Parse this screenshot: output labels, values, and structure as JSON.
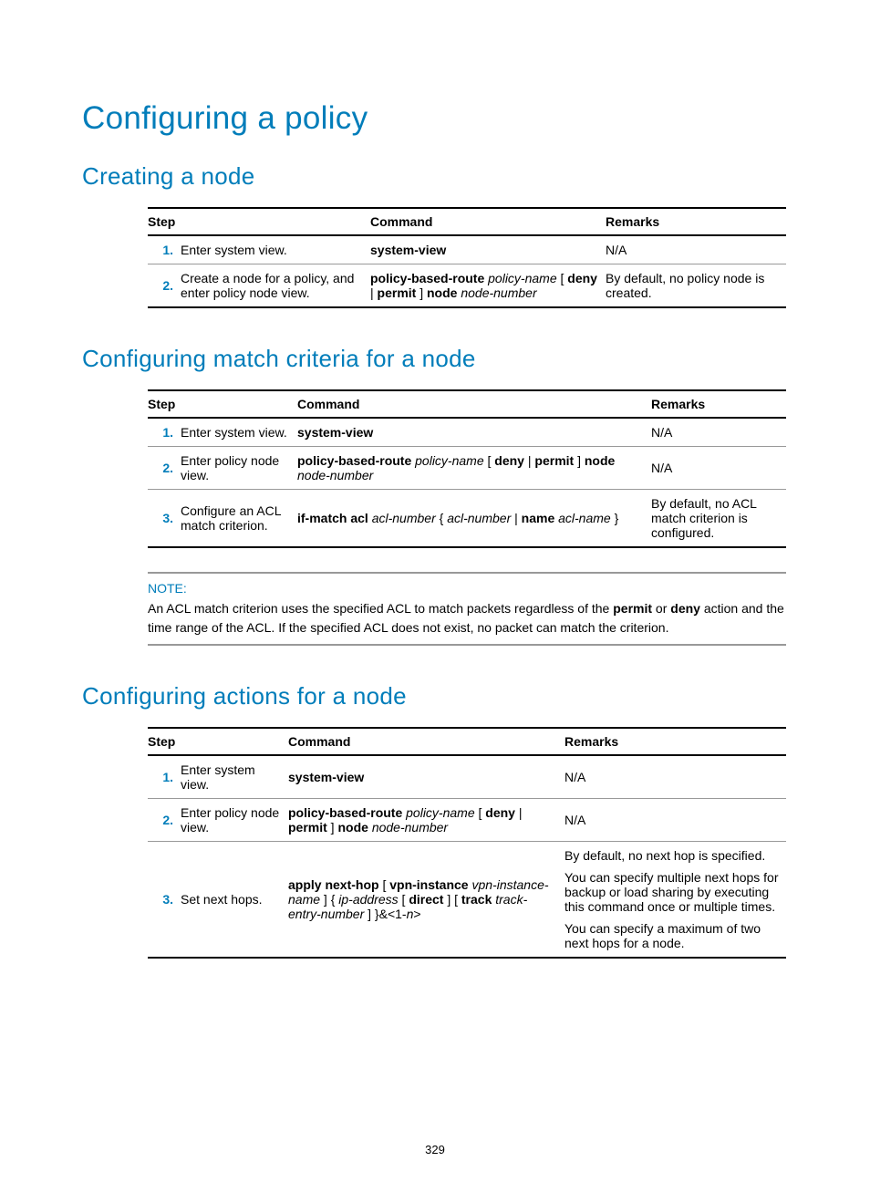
{
  "page_number": "329",
  "title": "Configuring a policy",
  "sections": [
    {
      "heading": "Creating a node",
      "table": {
        "headers": [
          "Step",
          "Command",
          "Remarks"
        ],
        "col_widths": {
          "step_desc": "200px",
          "command": "250px"
        },
        "rows": [
          {
            "num": "1.",
            "step": "Enter system view.",
            "command_html": "<span class='b'>system-view</span>",
            "remarks_html": "N/A"
          },
          {
            "num": "2.",
            "step": "Create a node for a policy, and enter policy node view.",
            "command_html": "<span class='b'>policy-based-route</span> <span class='i'>policy-name</span> [ <span class='b'>deny</span> | <span class='b'>permit</span> ] <span class='b'>node</span> <span class='i'>node-number</span>",
            "remarks_html": "By default, no policy node is created."
          }
        ]
      }
    },
    {
      "heading": "Configuring match criteria for a node",
      "table": {
        "headers": [
          "Step",
          "Command",
          "Remarks"
        ],
        "col_widths": {
          "step_desc": "120px",
          "command": "380px"
        },
        "rows": [
          {
            "num": "1.",
            "step": "Enter system view.",
            "command_html": "<span class='b'>system-view</span>",
            "remarks_html": "N/A"
          },
          {
            "num": "2.",
            "step": "Enter policy node view.",
            "command_html": "<span class='b'>policy-based-route</span> <span class='i'>policy-name</span> [ <span class='b'>deny</span> | <span class='b'>permit</span> ] <span class='b'>node</span> <span class='i'>node-number</span>",
            "remarks_html": "N/A"
          },
          {
            "num": "3.",
            "step": "Configure an ACL match criterion.",
            "command_html": "<span class='b'>if-match acl</span> <span class='i'>acl-number</span> { <span class='i'>acl-number</span> | <span class='b'>name</span> <span class='i'>acl-name</span> }",
            "remarks_html": "By default, no ACL match criterion is configured."
          }
        ]
      },
      "note": {
        "label": "NOTE:",
        "text_html": "An ACL match criterion uses the specified ACL to match packets regardless of the <span class='b'>permit</span> or <span class='b'>deny</span> action and the time range of the ACL. If the specified ACL does not exist, no packet can match the criterion."
      }
    },
    {
      "heading": "Configuring actions for a node",
      "table": {
        "headers": [
          "Step",
          "Command",
          "Remarks"
        ],
        "col_widths": {
          "step_desc": "110px",
          "command": "295px"
        },
        "rows": [
          {
            "num": "1.",
            "step": "Enter system view.",
            "command_html": "<span class='b'>system-view</span>",
            "remarks_html": "N/A"
          },
          {
            "num": "2.",
            "step": "Enter policy node view.",
            "command_html": "<span class='b'>policy-based-route</span> <span class='i'>policy-name</span> [ <span class='b'>deny</span> | <span class='b'>permit</span> ] <span class='b'>node</span> <span class='i'>node-number</span>",
            "remarks_html": "N/A"
          },
          {
            "num": "3.",
            "step": "Set next hops.",
            "command_html": "<span class='b'>apply next-hop</span> [ <span class='b'>vpn-instance</span> <span class='i'>vpn-instance-name</span> ] { <span class='i'>ip-address</span> [ <span class='b'>direct</span> ] [ <span class='b'>track</span> <span class='i'>track-entry-number</span> ] }&amp;&lt;1-<span class='i'>n</span>&gt;",
            "remarks_html": "<div class='multi-rem'><p>By default, no next hop is specified.</p><p>You can specify multiple next hops for backup or load sharing by executing this command once or multiple times.</p><p>You can specify a maximum of two next hops for a node.</p></div>"
          }
        ]
      }
    }
  ]
}
